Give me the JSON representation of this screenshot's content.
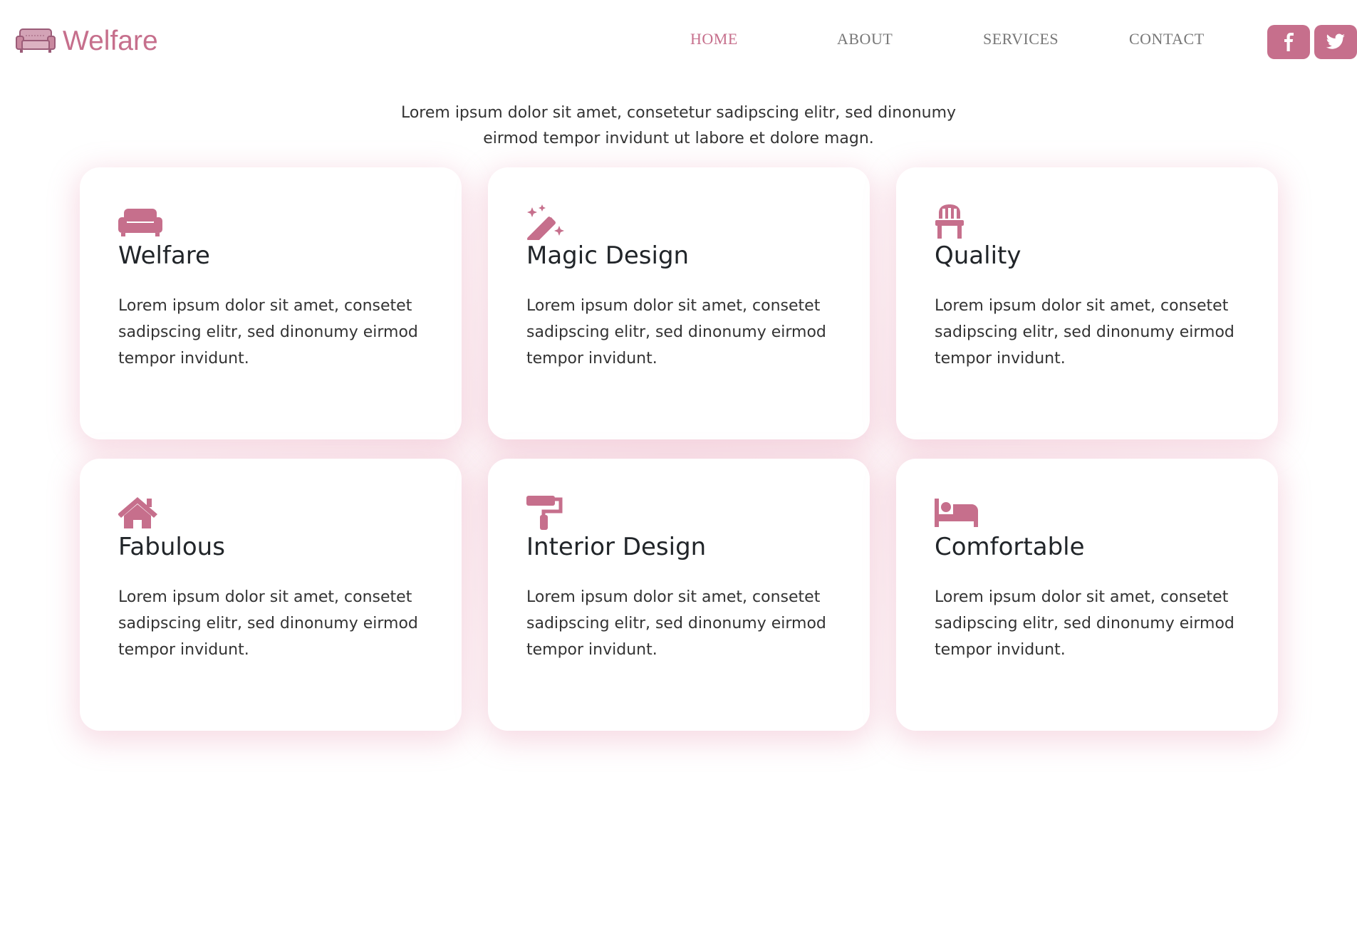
{
  "brand": {
    "name": "Welfare",
    "icon": "sofa-icon"
  },
  "nav": {
    "items": [
      {
        "label": "HOME",
        "active": true
      },
      {
        "label": "ABOUT",
        "active": false
      },
      {
        "label": "SERVICES",
        "active": false
      },
      {
        "label": "CONTACT",
        "active": false
      }
    ]
  },
  "social": [
    {
      "icon": "facebook-icon"
    },
    {
      "icon": "twitter-icon"
    }
  ],
  "intro": {
    "line1": "Lorem ipsum dolor sit amet, consetetur sadipscing elitr, sed dinonumy",
    "line2": "eirmod tempor invidunt ut labore et dolore magn."
  },
  "cards": [
    {
      "title": "Welfare",
      "icon": "couch-icon",
      "text": "Lorem ipsum dolor sit amet, consetet sadipscing elitr, sed dinonumy eirmod tempor invidunt."
    },
    {
      "title": "Magic Design",
      "icon": "magic-wand-icon",
      "text": "Lorem ipsum dolor sit amet, consetet sadipscing elitr, sed dinonumy eirmod tempor invidunt."
    },
    {
      "title": "Quality",
      "icon": "chair-icon",
      "text": "Lorem ipsum dolor sit amet, consetet sadipscing elitr, sed dinonumy eirmod tempor invidunt."
    },
    {
      "title": "Fabulous",
      "icon": "house-icon",
      "text": "Lorem ipsum dolor sit amet, consetet sadipscing elitr, sed dinonumy eirmod tempor invidunt."
    },
    {
      "title": "Interior Design",
      "icon": "paint-roller-icon",
      "text": "Lorem ipsum dolor sit amet, consetet sadipscing elitr, sed dinonumy eirmod tempor invidunt."
    },
    {
      "title": "Comfortable",
      "icon": "bed-icon",
      "text": "Lorem ipsum dolor sit amet, consetet sadipscing elitr, sed dinonumy eirmod tempor invidunt."
    }
  ],
  "colors": {
    "accent": "#c66f8c",
    "nav_text": "#777777",
    "body_text": "#333333",
    "heading": "#212529"
  }
}
